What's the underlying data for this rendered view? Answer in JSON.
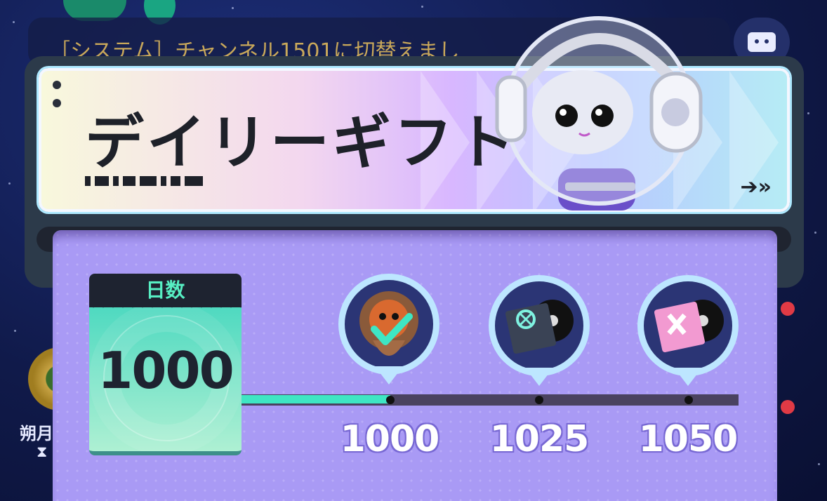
{
  "chat": {
    "message": "［システム］チャンネル1501に切替えまし"
  },
  "side": {
    "label": "朔月"
  },
  "banner": {
    "title": "デイリーギフト",
    "arrow_icon": "double-arrow-right-icon"
  },
  "days": {
    "label": "日数",
    "value": "1000"
  },
  "progress": {
    "current_day": 1000,
    "fill_fraction": 0.3
  },
  "milestones": [
    {
      "day": "1000",
      "reward": "character-bust-icon",
      "claimed": true
    },
    {
      "day": "1025",
      "reward": "music-record-pack-icon",
      "claimed": false
    },
    {
      "day": "1050",
      "reward": "music-record-pack-pink-icon",
      "claimed": false
    }
  ],
  "colors": {
    "panel": "#a99af5",
    "progress_fill": "#3ee6c3",
    "days_header_text": "#57efc3",
    "claimed_check": "#3ee6c3"
  }
}
